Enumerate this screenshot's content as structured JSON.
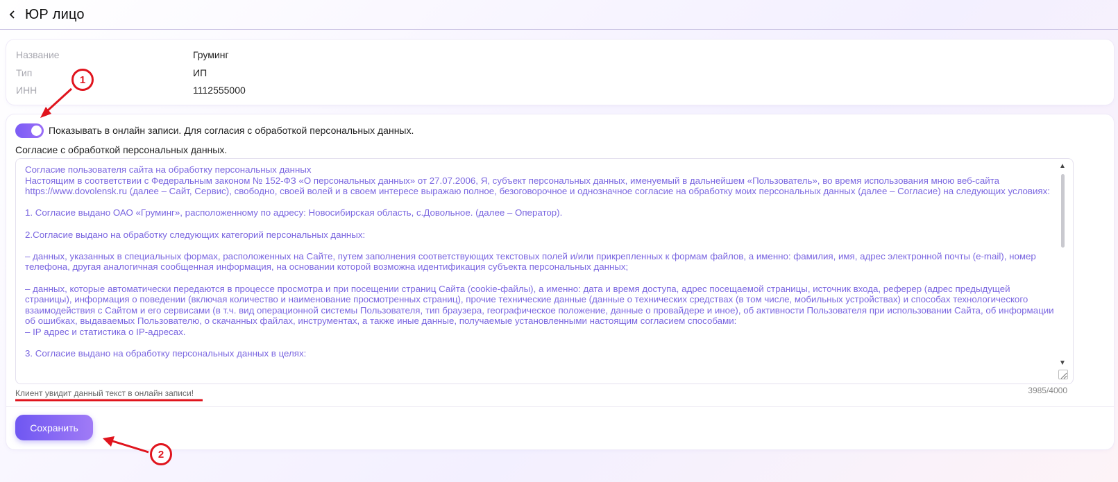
{
  "header": {
    "back_icon": "chevron-left-icon",
    "title": "ЮР лицо"
  },
  "info": {
    "rows": [
      {
        "label": "Название",
        "value": "Груминг"
      },
      {
        "label": "Тип",
        "value": "ИП"
      },
      {
        "label": "ИНН",
        "value": "1112555000"
      }
    ]
  },
  "consent": {
    "toggle_on": true,
    "toggle_label": "Показывать в онлайн записи. Для согласия с обработкой персональных данных.",
    "section_label": "Согласие с обработкой персональных данных.",
    "text": "Согласие пользователя сайта на обработку персональных данных\nНастоящим в соответствии с Федеральным законом № 152-ФЗ «О персональных данных» от 27.07.2006, Я, субъект персональных данных, именуемый в дальнейшем «Пользователь», во время использования мною веб-сайта https://www.dovolensk.ru (далее – Сайт, Сервис), свободно, своей волей и в своем интересе выражаю полное, безоговорочное и однозначное согласие на обработку моих персональных данных (далее – Согласие) на следующих условиях:\n\n1. Согласие выдано ОАО «Груминг», расположенному по адресу: Новосибирская область, с.Довольное. (далее – Оператор).\n\n2.Согласие выдано на обработку следующих категорий персональных данных:\n\n– данных, указанных в специальных формах, расположенных на Сайте, путем заполнения соответствующих текстовых полей и/или прикрепленных к формам файлов, а именно: фамилия, имя, адрес электронной почты (e-mail), номер телефона, другая аналогичная сообщенная информация, на основании которой возможна идентификация субъекта персональных данных;\n\n– данных, которые автоматически передаются в процессе просмотра и при посещении страниц Сайта (cookie-файлы), а именно: дата и время доступа, адрес посещаемой страницы, источник входа, реферер (адрес предыдущей страницы), информация о поведении (включая количество и наименование просмотренных страниц), прочие технические данные (данные о технических средствах (в том числе, мобильных устройствах) и способах технологического взаимодействия с Сайтом и его сервисами (в т.ч. вид операционной системы Пользователя, тип браузера, географическое положение, данные о провайдере и иное), об активности Пользователя при использовании Сайта, об информации об ошибках, выдаваемых Пользователю, о скачанных файлах, инструментах, а также иные данные, получаемые установленными настоящим согласием способами:\n– IP адрес и статистика о IP-адресах.\n\n3. Согласие выдано на обработку персональных данных в целях:",
    "hint": "Клиент увидит данный текст в онлайн записи!",
    "counter": "3985/4000"
  },
  "actions": {
    "save_label": "Сохранить"
  },
  "annotations": {
    "marker_1": "1",
    "marker_2": "2",
    "color": "#e0141d"
  },
  "colors": {
    "accent": "#7b5cf5",
    "text_purple": "#7a66e0"
  }
}
